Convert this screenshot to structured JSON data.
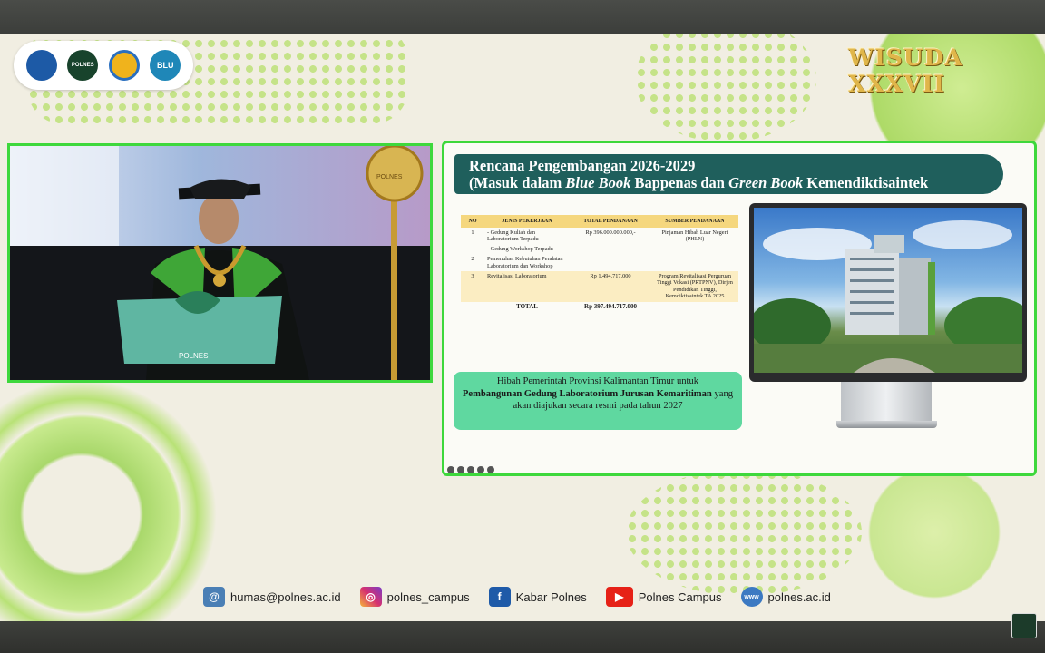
{
  "header": {
    "event_title": "WISUDA XXXVII",
    "logos": [
      {
        "name": "kemendikti-logo",
        "text": ""
      },
      {
        "name": "polnes-logo",
        "text": "POLNES"
      },
      {
        "name": "blu-badge-logo",
        "text": ""
      },
      {
        "name": "menuju-blu-logo",
        "text": "BLU"
      }
    ]
  },
  "video": {
    "podium_label": "POLNES",
    "mace_label": "POLNES"
  },
  "slide": {
    "title_line1": "Rencana Pengembangan 2026-2029",
    "title_line2_prefix": "(Masuk dalam ",
    "title_blue_book": "Blue Book",
    "title_mid": " Bappenas dan ",
    "title_green_book": "Green Book",
    "title_suffix": "  Kemendiktisaintek",
    "table": {
      "headers": [
        "NO",
        "JENIS PEKERJAAN",
        "TOTAL PENDANAAN",
        "SUMBER PENDANAAN"
      ],
      "rows": [
        {
          "no": "1",
          "jenis": [
            "Gedung Kuliah dan Laboratorium Terpadu",
            "Gedung Workshop Terpadu"
          ],
          "total": "Rp 396.000.000.000,-",
          "sumber": "Pinjaman Hibah Luar Negeri (PHLN)"
        },
        {
          "no": "2",
          "jenis": [
            "Pemenuhan Kebutuhan Peralatan Laboratorium dan Workshop"
          ],
          "total": "",
          "sumber": ""
        },
        {
          "no": "3",
          "jenis": [
            "Revitalisasi Laboratorium"
          ],
          "total": "Rp 1.494.717.000",
          "sumber": "Program Revitalisasi Perguruan Tinggi Vokasi (PRTPNV), Dirjen Pendidikan Tinggi, Kemdiktisaintek  TA 2025"
        }
      ],
      "total_label": "TOTAL",
      "total_value": "Rp 397.494.717.000"
    },
    "hibah": {
      "line1": "Hibah Pemerintah Provinsi Kalimantan Timur untuk",
      "bold": "Pembangunan Gedung Laboratorium Jurusan Kemaritiman",
      "rest": " yang akan diajukan secara resmi pada tahun 2027"
    }
  },
  "footer": {
    "items": [
      {
        "icon": "email-icon",
        "label": "humas@polnes.ac.id",
        "color": "#4a7fb5"
      },
      {
        "icon": "instagram-icon",
        "label": "polnes_campus",
        "color": "#d6316f"
      },
      {
        "icon": "facebook-icon",
        "label": "Kabar Polnes",
        "color": "#1e5aa8"
      },
      {
        "icon": "youtube-icon",
        "label": "Polnes Campus",
        "color": "#e62117"
      },
      {
        "icon": "www-icon",
        "label": "polnes.ac.id",
        "color": "#3c79c2"
      }
    ]
  },
  "colors": {
    "accent_green": "#3ed83c",
    "title_bg": "#1f5f5c",
    "hibah_bg": "#5fd8a0",
    "table_header": "#f5d77e"
  }
}
